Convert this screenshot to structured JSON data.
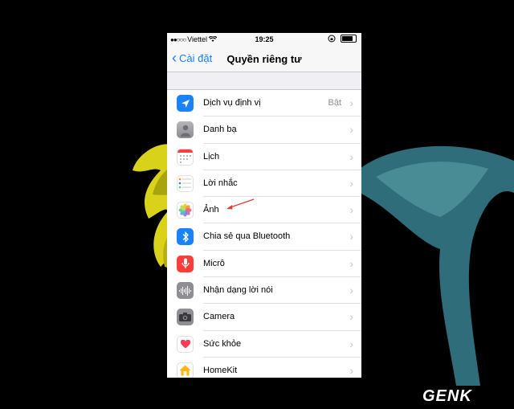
{
  "status": {
    "carrier": "Viettel",
    "time": "19:25",
    "signal": "●●○○○"
  },
  "nav": {
    "back_label": "Cài đặt",
    "title": "Quyền riêng tư"
  },
  "items": [
    {
      "label": "Dịch vụ định vị",
      "value": "Bật",
      "icon": "location-icon",
      "color": "#1a82fb"
    },
    {
      "label": "Danh bạ",
      "value": "",
      "icon": "contacts-icon",
      "color": "#9a9aa0"
    },
    {
      "label": "Lịch",
      "value": "",
      "icon": "calendar-icon",
      "color": "#ffffff"
    },
    {
      "label": "Lời nhắc",
      "value": "",
      "icon": "reminders-icon",
      "color": "#ffffff"
    },
    {
      "label": "Ảnh",
      "value": "",
      "icon": "photos-icon",
      "color": "#ffffff"
    },
    {
      "label": "Chia sẻ qua Bluetooth",
      "value": "",
      "icon": "bluetooth-icon",
      "color": "#1a82fb"
    },
    {
      "label": "Micrô",
      "value": "",
      "icon": "microphone-icon",
      "color": "#fc3d39"
    },
    {
      "label": "Nhận dạng lời nói",
      "value": "",
      "icon": "speech-recognition-icon",
      "color": "#8e8e93"
    },
    {
      "label": "Camera",
      "value": "",
      "icon": "camera-icon",
      "color": "#8e8e93"
    },
    {
      "label": "Sức khỏe",
      "value": "",
      "icon": "health-icon",
      "color": "#ffffff"
    },
    {
      "label": "HomeKit",
      "value": "",
      "icon": "homekit-icon",
      "color": "#ffffff"
    }
  ],
  "annotation_color": "#e23b3b",
  "watermark": "GENK"
}
